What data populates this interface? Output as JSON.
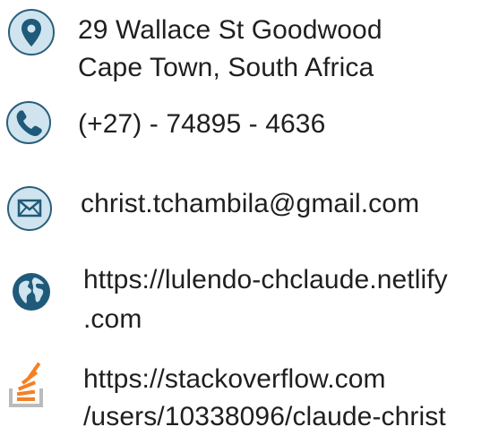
{
  "contacts": {
    "address": {
      "icon": "location-pin-icon",
      "line1": "29 Wallace St Goodwood",
      "line2": "Cape Town, South Africa"
    },
    "phone": {
      "icon": "phone-icon",
      "line1": "(+27) - 74895 - 4636"
    },
    "email": {
      "icon": "envelope-icon",
      "line1": "christ.tchambila@gmail.com"
    },
    "website": {
      "icon": "globe-icon",
      "line1": "https://lulendo-chclaude.netlify",
      "line2": ".com"
    },
    "stackoverflow": {
      "icon": "stackoverflow-icon",
      "line1": "https://stackoverflow.com",
      "line2": "/users/10338096/claude-christ"
    }
  },
  "colors": {
    "icon_circle_fill": "#cfe4ee",
    "icon_circle_stroke": "#2a5f7a",
    "icon_glyph": "#1f5a7a",
    "text": "#1f1f1f",
    "stackoverflow_orange": "#f48024",
    "stackoverflow_gray": "#bcbbbb"
  }
}
